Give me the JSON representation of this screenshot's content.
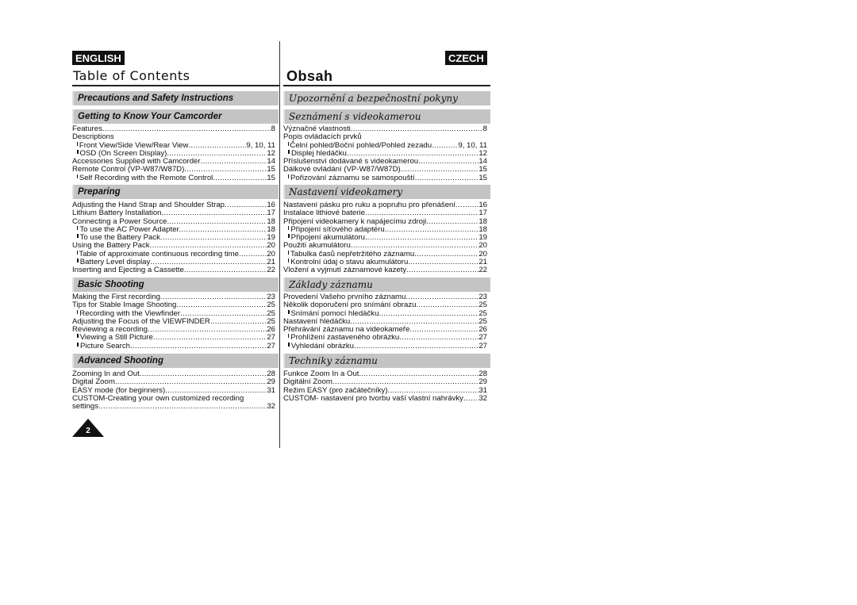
{
  "english": {
    "badge": "ENGLISH",
    "title": "Table of Contents",
    "sections": [
      {
        "heading": "Precautions and Safety Instructions",
        "entries": []
      },
      {
        "heading": "Getting to Know Your Camcorder",
        "entries": [
          {
            "text": "Features",
            "page": "8"
          },
          {
            "text": "Descriptions",
            "page": ""
          },
          {
            "text": "Front View/Side View/Rear View",
            "page": "9, 10, 11",
            "sub": true
          },
          {
            "text": "OSD (On Screen Display)",
            "page": "12",
            "sub": true
          },
          {
            "text": "Accessories Supplied with Camcorder",
            "page": "14"
          },
          {
            "text": "Remote Control (VP-W87/W87D)",
            "page": "15"
          },
          {
            "text": "Self Recording with the Remote Control",
            "page": "15",
            "sub": true
          }
        ]
      },
      {
        "heading": "Preparing",
        "entries": [
          {
            "text": "Adjusting the Hand Strap and Shoulder Strap",
            "page": "16"
          },
          {
            "text": "Lithium Battery Installation",
            "page": "17"
          },
          {
            "text": "Connecting a Power Source",
            "page": "18"
          },
          {
            "text": "To use the AC Power Adapter",
            "page": "18",
            "sub": true
          },
          {
            "text": "To use the Battery Pack",
            "page": "19",
            "sub": true
          },
          {
            "text": "Using the Battery Pack",
            "page": "20"
          },
          {
            "text": "Table of approximate continuous recording time",
            "page": "20",
            "sub": true
          },
          {
            "text": "Battery Level display",
            "page": "21",
            "sub": true
          },
          {
            "text": "Inserting and Ejecting a Cassette",
            "page": "22"
          }
        ]
      },
      {
        "heading": "Basic Shooting",
        "entries": [
          {
            "text": "Making the First recording",
            "page": "23"
          },
          {
            "text": "Tips for Stable Image Shooting",
            "page": "25"
          },
          {
            "text": "Recording with the Viewfinder",
            "page": "25",
            "sub": true
          },
          {
            "text": "Adjusting the Focus of the VIEWFINDER",
            "page": "25"
          },
          {
            "text": "Reviewing a recording",
            "page": "26"
          },
          {
            "text": "Viewing a Still Picture",
            "page": "27",
            "sub": true
          },
          {
            "text": "Picture Search",
            "page": "27",
            "sub": true
          }
        ]
      },
      {
        "heading": "Advanced Shooting",
        "entries": [
          {
            "text": "Zooming In and Out",
            "page": "28"
          },
          {
            "text": "Digital Zoom",
            "page": "29"
          },
          {
            "text": "EASY mode (for beginners)",
            "page": "31"
          },
          {
            "text": "CUSTOM-Creating your own customized recording",
            "page": ""
          },
          {
            "text": "settings",
            "page": "32"
          }
        ]
      }
    ]
  },
  "czech": {
    "badge": "CZECH",
    "title": "Obsah",
    "sections": [
      {
        "heading": "Upozornění a bezpečnostní pokyny",
        "entries": []
      },
      {
        "heading": "Seznámení s videokamerou",
        "entries": [
          {
            "text": "Význačné vlastnosti",
            "page": "8"
          },
          {
            "text": "Popis ovládacích prvků",
            "page": ""
          },
          {
            "text": "Čelní pohled/Boční pohled/Pohled zezadu",
            "page": "9, 10, 11",
            "sub": true
          },
          {
            "text": "Displej hledáčku",
            "page": "12",
            "sub": true
          },
          {
            "text": "Příslušenství dodávané s videokamerou",
            "page": "14"
          },
          {
            "text": "Dálkové ovládání (VP-W87/W87D)",
            "page": "15"
          },
          {
            "text": "Pořizování záznamu se samospouští",
            "page": "15",
            "sub": true
          }
        ]
      },
      {
        "heading": "Nastavení videokamery",
        "entries": [
          {
            "text": "Nastavení pásku pro ruku a popruhu pro přenášení",
            "page": "16"
          },
          {
            "text": "Instalace lithiové baterie",
            "page": "17"
          },
          {
            "text": "Připojení videokamery k napájecímu zdroji",
            "page": "18"
          },
          {
            "text": "Připojení síťového adaptéru",
            "page": "18",
            "sub": true
          },
          {
            "text": "Připojení akumulátoru.",
            "page": "19",
            "sub": true
          },
          {
            "text": "Použití akumulátoru",
            "page": "20"
          },
          {
            "text": "Tabulka časů nepřetržitého záznamu",
            "page": "20",
            "sub": true
          },
          {
            "text": "Kontrolní údaj o stavu akumulátoru",
            "page": "21",
            "sub": true
          },
          {
            "text": "Vložení a vyjmutí záznamové kazety",
            "page": "22"
          }
        ]
      },
      {
        "heading": "Základy záznamu",
        "entries": [
          {
            "text": "Provedení Vašeho prvního záznamu",
            "page": "23"
          },
          {
            "text": "Několik doporučení pro snímání obrazu",
            "page": "25"
          },
          {
            "text": "Snímání pomocí hledáčku",
            "page": "25",
            "sub": true
          },
          {
            "text": "Nastavení hledáčku",
            "page": "25"
          },
          {
            "text": "Přehrávání záznamu na videokameře",
            "page": "26"
          },
          {
            "text": "Prohlížení zastaveného obrázku",
            "page": "27",
            "sub": true
          },
          {
            "text": "Vyhledání obrázku",
            "page": "27",
            "sub": true
          }
        ]
      },
      {
        "heading": "Techniky záznamu",
        "entries": [
          {
            "text": "Funkce Zoom In a Out",
            "page": "28"
          },
          {
            "text": "Digitální Zoom",
            "page": "29"
          },
          {
            "text": "Režim EASY (pro začátečníky)",
            "page": "31"
          },
          {
            "text": "CUSTOM- nastavení pro tvorbu vaší vlastní nahrávky",
            "page": "32"
          }
        ]
      }
    ]
  },
  "page_number": "2"
}
